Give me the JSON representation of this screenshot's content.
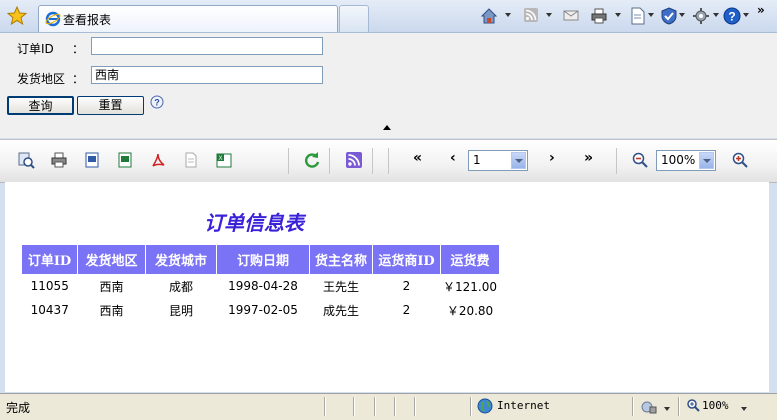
{
  "browser": {
    "tab_title": "查看报表",
    "toolbar_icons": [
      "favorites-star-icon",
      "home-icon",
      "feeds-icon",
      "mail-icon",
      "print-icon",
      "page-icon",
      "safety-icon",
      "tools-icon",
      "help-icon",
      "chevron-more-icon"
    ]
  },
  "query": {
    "order_id_label": "订单ID",
    "order_id_colon": "：",
    "order_id_value": "",
    "region_label": "发货地区",
    "region_colon": "：",
    "region_value": "西南",
    "query_button": "查询",
    "reset_button": "重置"
  },
  "report_toolbar": {
    "nav_first": "«",
    "nav_prev": "‹",
    "nav_next": "›",
    "nav_last": "»",
    "page_value": "1",
    "zoom_value": "100%"
  },
  "report": {
    "title": "订单信息表",
    "columns": [
      "订单ID",
      "发货地区",
      "发货城市",
      "订购日期",
      "货主名称",
      "运货商ID",
      "运货费"
    ],
    "rows": [
      [
        "11055",
        "西南",
        "成都",
        "1998-04-28",
        "王先生",
        "2",
        "￥121.00"
      ],
      [
        "10437",
        "西南",
        "昆明",
        "1997-02-05",
        "成先生",
        "2",
        "￥20.80"
      ]
    ]
  },
  "statusbar": {
    "status": "完成",
    "zone": "Internet",
    "zoom": "100%"
  },
  "colors": {
    "header_bg": "#7b73f5",
    "title_color": "#3a22d8"
  }
}
